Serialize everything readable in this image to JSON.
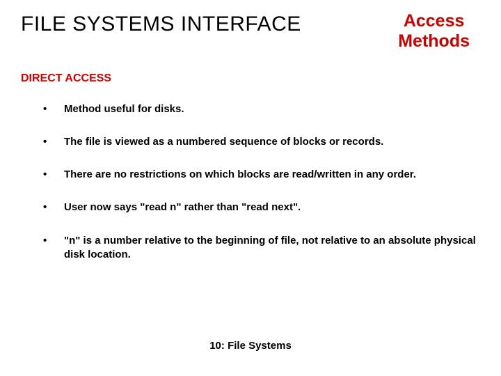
{
  "header": {
    "main_title": "FILE SYSTEMS INTERFACE",
    "subtitle_line1": "Access",
    "subtitle_line2": "Methods"
  },
  "section": {
    "heading": "DIRECT ACCESS"
  },
  "bullets": {
    "items": [
      "Method useful for disks.",
      "The file is viewed as a numbered sequence of blocks or records.",
      "There are no restrictions on which blocks are read/written in any order.",
      "User now says \"read n\" rather than \"read next\".",
      "\"n\" is a number relative to the beginning of file, not relative to an absolute physical disk location."
    ]
  },
  "footer": {
    "text": "10: File Systems"
  }
}
